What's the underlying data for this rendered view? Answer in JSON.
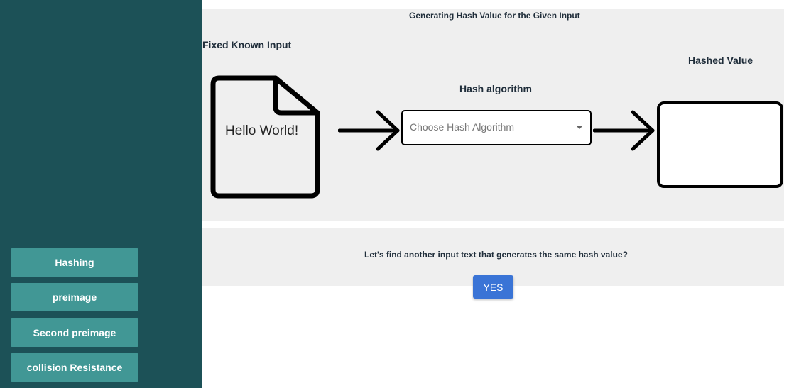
{
  "sidebar": {
    "items": [
      {
        "label": "Hashing"
      },
      {
        "label": "preimage"
      },
      {
        "label": "Second preimage"
      },
      {
        "label": "collision Resistance"
      }
    ]
  },
  "main": {
    "title": "Generating Hash Value for the Given Input",
    "input_label": "Fixed Known Input",
    "input_text": "Hello World!",
    "algorithm_label": "Hash algorithm",
    "algorithm_placeholder": "Choose Hash Algorithm",
    "output_label": "Hashed Value",
    "output_value": ""
  },
  "collision_prompt": {
    "question": "Let's find another input text that generates the same hash value?",
    "yes_label": "YES"
  },
  "colors": {
    "sidebar_bg": "#1c5157",
    "nav_button_bg": "#419795",
    "panel_bg": "#efefef",
    "primary_button": "#3a74d6"
  }
}
